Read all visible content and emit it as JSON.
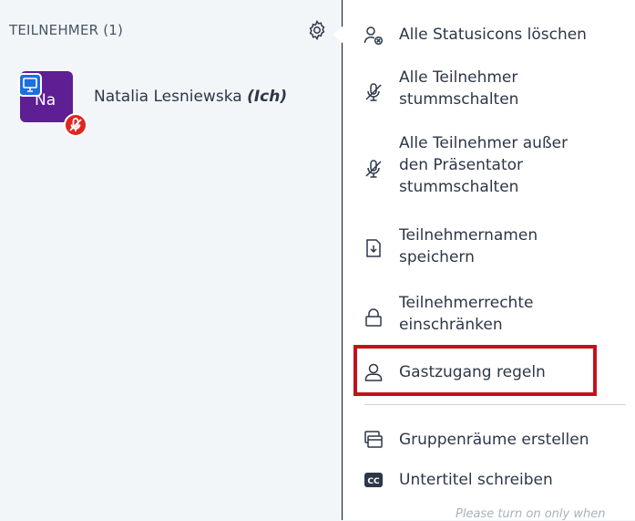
{
  "participants": {
    "title": "TEILNEHMER (1)",
    "users": [
      {
        "initials": "Na",
        "name": "Natalia Lesniewska",
        "suffix": "(Ich)"
      }
    ]
  },
  "menu": {
    "items": [
      {
        "label": "Alle Statusicons löschen",
        "icon": "clear-status-icon"
      },
      {
        "label": "Alle Teilnehmer\nstummschalten",
        "icon": "mic-off-icon"
      },
      {
        "label": "Alle Teilnehmer außer\nden Präsentator\nstummschalten",
        "icon": "mic-off-icon"
      },
      {
        "label": "Teilnehmernamen\nspeichern",
        "icon": "download-icon"
      },
      {
        "label": "Teilnehmerrechte\neinschränken",
        "icon": "lock-icon"
      },
      {
        "label": "Gastzugang regeln",
        "icon": "user-icon"
      },
      {
        "label": "Gruppenräume erstellen",
        "icon": "breakout-rooms-icon"
      },
      {
        "label": "Untertitel schreiben",
        "icon": "closed-captions-icon"
      }
    ]
  },
  "footer": {
    "text": "Please turn on only when"
  },
  "colors": {
    "highlight": "#c3121b",
    "avatar": "#5e1e94",
    "presenter_badge": "#1b6fe0",
    "muted_badge": "#df2720",
    "dark_strip": "#06172a"
  }
}
